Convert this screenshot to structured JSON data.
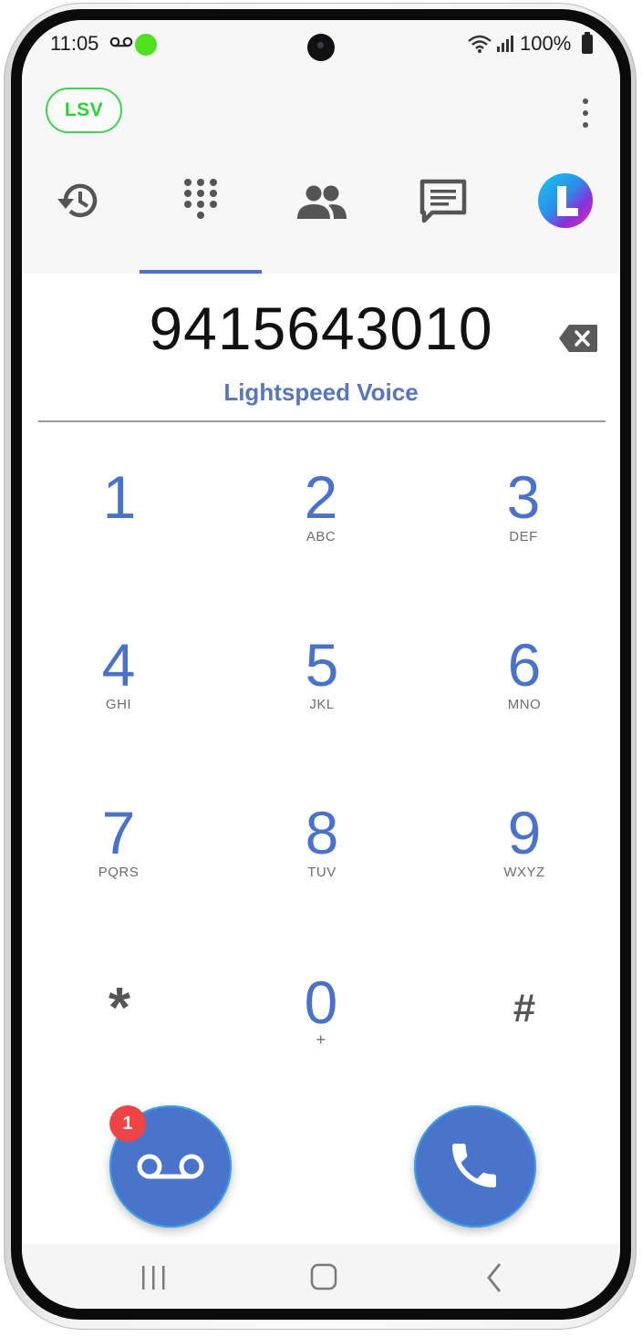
{
  "status_bar": {
    "time": "11:05",
    "battery_percent": "100%",
    "icons": [
      "voicemail-icon",
      "green-dot",
      "wifi-icon",
      "signal-icon",
      "battery-icon"
    ]
  },
  "app": {
    "brand_badge": "LSV",
    "tabs": [
      {
        "name": "recents",
        "icon": "history-icon"
      },
      {
        "name": "dialpad",
        "icon": "dialpad-icon",
        "selected": true
      },
      {
        "name": "contacts",
        "icon": "people-icon"
      },
      {
        "name": "messages",
        "icon": "message-icon"
      },
      {
        "name": "lightspeed",
        "icon": "app-logo-icon"
      }
    ]
  },
  "dialer": {
    "number": "9415643010",
    "provider": "Lightspeed Voice"
  },
  "keypad": [
    {
      "digit": "1",
      "letters": ""
    },
    {
      "digit": "2",
      "letters": "ABC"
    },
    {
      "digit": "3",
      "letters": "DEF"
    },
    {
      "digit": "4",
      "letters": "GHI"
    },
    {
      "digit": "5",
      "letters": "JKL"
    },
    {
      "digit": "6",
      "letters": "MNO"
    },
    {
      "digit": "7",
      "letters": "PQRS"
    },
    {
      "digit": "8",
      "letters": "TUV"
    },
    {
      "digit": "9",
      "letters": "WXYZ"
    },
    {
      "digit": "*",
      "letters": ""
    },
    {
      "digit": "0",
      "letters": "+"
    },
    {
      "digit": "#",
      "letters": ""
    }
  ],
  "actions": {
    "voicemail_badge": "1"
  },
  "colors": {
    "accent": "#4a72c9",
    "brand_green": "#3ed34f",
    "badge_red": "#ef4446"
  }
}
